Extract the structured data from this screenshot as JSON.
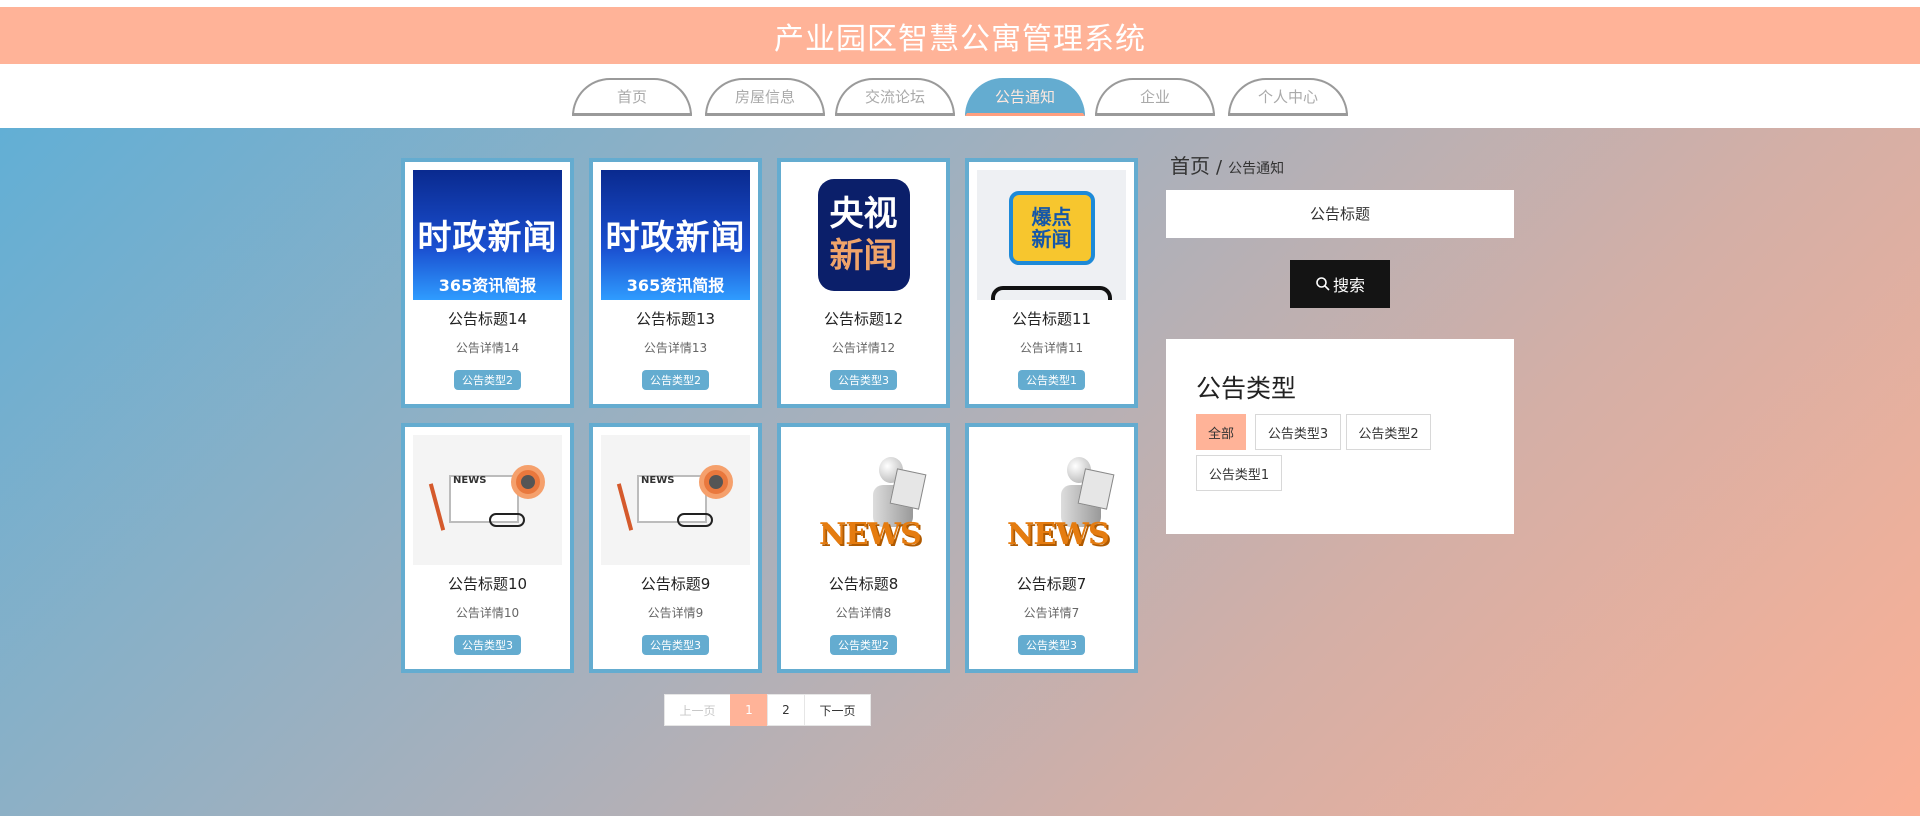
{
  "app": {
    "title": "产业园区智慧公寓管理系统"
  },
  "nav": {
    "items": [
      {
        "label": "首页"
      },
      {
        "label": "房屋信息"
      },
      {
        "label": "交流论坛"
      },
      {
        "label": "公告通知",
        "active": true
      },
      {
        "label": "企业"
      },
      {
        "label": "个人中心"
      }
    ]
  },
  "cards": [
    {
      "title": "公告标题14",
      "desc": "公告详情14",
      "type": "公告类型2",
      "image": "时政新闻 365资讯简报"
    },
    {
      "title": "公告标题13",
      "desc": "公告详情13",
      "type": "公告类型2",
      "image": "时政新闻 365资讯简报"
    },
    {
      "title": "公告标题12",
      "desc": "公告详情12",
      "type": "公告类型3",
      "image": "央视新闻"
    },
    {
      "title": "公告标题11",
      "desc": "公告详情11",
      "type": "公告类型1",
      "image": "爆点新闻"
    },
    {
      "title": "公告标题10",
      "desc": "公告详情10",
      "type": "公告类型3",
      "image": "NEWS"
    },
    {
      "title": "公告标题9",
      "desc": "公告详情9",
      "type": "公告类型3",
      "image": "NEWS"
    },
    {
      "title": "公告标题8",
      "desc": "公告详情8",
      "type": "公告类型2",
      "image": "NEWS"
    },
    {
      "title": "公告标题7",
      "desc": "公告详情7",
      "type": "公告类型3",
      "image": "NEWS"
    }
  ],
  "thumb_text": {
    "shizheng_big": "时政新闻",
    "shizheng_small": "365资讯简报",
    "cctv_l1": "央视",
    "cctv_l2": "新闻",
    "hot_l1": "爆点",
    "hot_l2": "新闻",
    "news": "NEWS"
  },
  "pager": {
    "prev": "上一页",
    "pages": [
      "1",
      "2"
    ],
    "current": "1",
    "next": "下一页"
  },
  "breadcrumb": {
    "home": "首页",
    "sep": "/",
    "current": "公告通知"
  },
  "search": {
    "placeholder": "公告标题",
    "button": "搜索"
  },
  "types": {
    "heading": "公告类型",
    "items": [
      {
        "label": "全部",
        "active": true
      },
      {
        "label": "公告类型3"
      },
      {
        "label": "公告类型2"
      },
      {
        "label": "公告类型1"
      }
    ]
  },
  "colors": {
    "header": "#ffb398",
    "accent_blue": "#64acd0",
    "accent_orange": "#ffb398",
    "search_button": "#141414"
  },
  "icons": {
    "search": "search-icon"
  }
}
